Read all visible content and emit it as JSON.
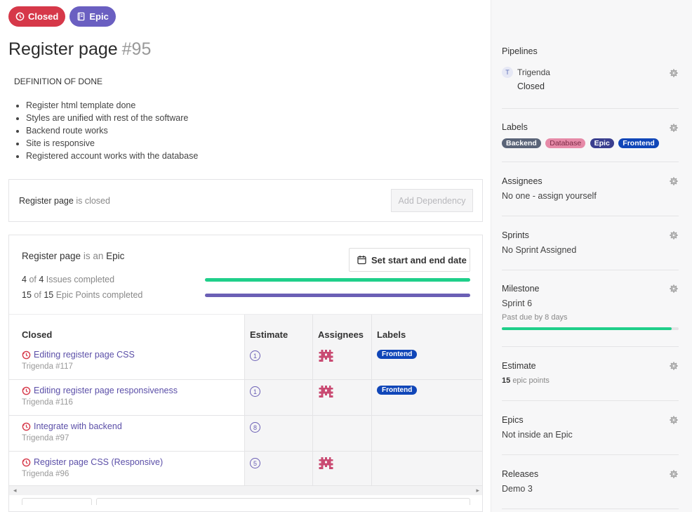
{
  "badges": {
    "status": "Closed",
    "type": "Epic"
  },
  "title": {
    "text": "Register page",
    "number": "#95"
  },
  "description": {
    "heading": "DEFINITION OF DONE",
    "items": [
      "Register html template done",
      "Styles are unified with rest of the software",
      "Backend route works",
      "Site is responsive",
      "Registered account works with the database"
    ]
  },
  "dependency": {
    "name": "Register page",
    "state": "is closed",
    "button": "Add Dependency"
  },
  "epic": {
    "name": "Register page",
    "is_an": "is an",
    "kind": "Epic",
    "date_button": "Set start and end date",
    "issues": {
      "done": "4",
      "of": "of",
      "total": "4",
      "label": "Issues completed",
      "fraction": 1.0,
      "color": "#1fcf8a"
    },
    "points": {
      "done": "15",
      "of": "of",
      "total": "15",
      "label": "Epic Points completed",
      "fraction": 1.0,
      "color": "#6b5fb5"
    }
  },
  "table": {
    "headers": {
      "name": "Closed",
      "estimate": "Estimate",
      "assignees": "Assignees",
      "labels": "Labels"
    },
    "rows": [
      {
        "title": "Editing register page CSS",
        "sub": "Trigenda #117",
        "estimate": "1",
        "assignee": true,
        "label": "Frontend"
      },
      {
        "title": "Editing register page responsiveness",
        "sub": "Trigenda #116",
        "estimate": "1",
        "assignee": true,
        "label": "Frontend"
      },
      {
        "title": "Integrate with backend",
        "sub": "Trigenda #97",
        "estimate": "8",
        "assignee": false,
        "label": ""
      },
      {
        "title": "Register page CSS (Responsive)",
        "sub": "Trigenda #96",
        "estimate": "5",
        "assignee": true,
        "label": ""
      }
    ]
  },
  "sidebar": {
    "pipelines": {
      "heading": "Pipelines",
      "workspace_initial": "T",
      "workspace": "Trigenda",
      "pipeline": "Closed"
    },
    "labels": {
      "heading": "Labels",
      "items": [
        {
          "name": "Backend",
          "color": "#5a6478",
          "text": "#ffffff"
        },
        {
          "name": "Database",
          "color": "#e68aa8",
          "text": "#7a2a45"
        },
        {
          "name": "Epic",
          "color": "#3a3f8f",
          "text": "#ffffff"
        },
        {
          "name": "Frontend",
          "color": "#1046b8",
          "text": "#ffffff"
        }
      ]
    },
    "assignees": {
      "heading": "Assignees",
      "value": "No one - assign yourself"
    },
    "sprints": {
      "heading": "Sprints",
      "value": "No Sprint Assigned"
    },
    "milestone": {
      "heading": "Milestone",
      "value": "Sprint 6",
      "due": "Past due by 8 days",
      "progress": 0.96
    },
    "estimate": {
      "heading": "Estimate",
      "points": "15",
      "unit": "epic points"
    },
    "epics": {
      "heading": "Epics",
      "value": "Not inside an Epic"
    },
    "releases": {
      "heading": "Releases",
      "value": "Demo 3"
    }
  },
  "colors": {
    "closed_badge": "#d63849",
    "epic_badge": "#6a5fc1",
    "accent_link": "#5b4fa8",
    "closed_icon": "#d63849"
  }
}
